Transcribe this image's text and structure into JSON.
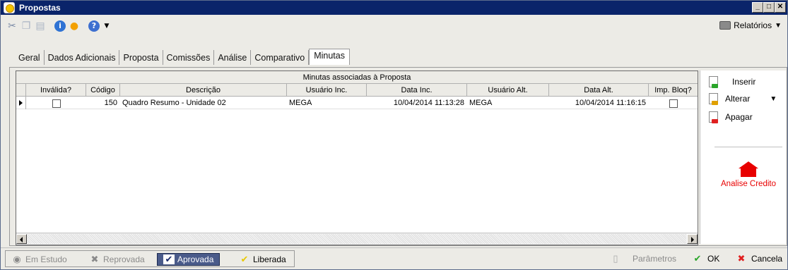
{
  "window": {
    "title": "Propostas"
  },
  "toolbar": {
    "icons": [
      "cut-icon",
      "copy-icon",
      "paste-icon",
      "info-icon",
      "user-icon",
      "help-icon"
    ],
    "reports_label": "Relatórios"
  },
  "tabs": [
    {
      "label": "Geral",
      "active": false
    },
    {
      "label": "Dados Adicionais",
      "active": false
    },
    {
      "label": "Proposta",
      "active": false
    },
    {
      "label": "Comissões",
      "active": false
    },
    {
      "label": "Análise",
      "active": false
    },
    {
      "label": "Comparativo",
      "active": false
    },
    {
      "label": "Minutas",
      "active": true
    }
  ],
  "grid": {
    "caption": "Minutas associadas à Proposta",
    "columns": [
      "Inválida?",
      "Código",
      "Descrição",
      "Usuário Inc.",
      "Data Inc.",
      "Usuário Alt.",
      "Data Alt.",
      "Imp. Bloq?"
    ],
    "rows": [
      {
        "invalida": false,
        "codigo": "150",
        "descricao": "Quadro Resumo - Unidade 02",
        "usuario_inc": "MEGA",
        "data_inc": "10/04/2014 11:13:28",
        "usuario_alt": "MEGA",
        "data_alt": "10/04/2014 11:16:15",
        "imp_bloq": false
      }
    ]
  },
  "side": {
    "insert_label": "Inserir",
    "alter_label": "Alterar",
    "delete_label": "Apagar",
    "analise_label": "Analise Credito",
    "analise_color": "#e80000"
  },
  "status": {
    "em_estudo": "Em Estudo",
    "reprovada": "Reprovada",
    "aprovada": "Aprovada",
    "liberada": "Liberada",
    "parametros": "Parâmetros",
    "ok": "OK",
    "cancela": "Cancela"
  }
}
